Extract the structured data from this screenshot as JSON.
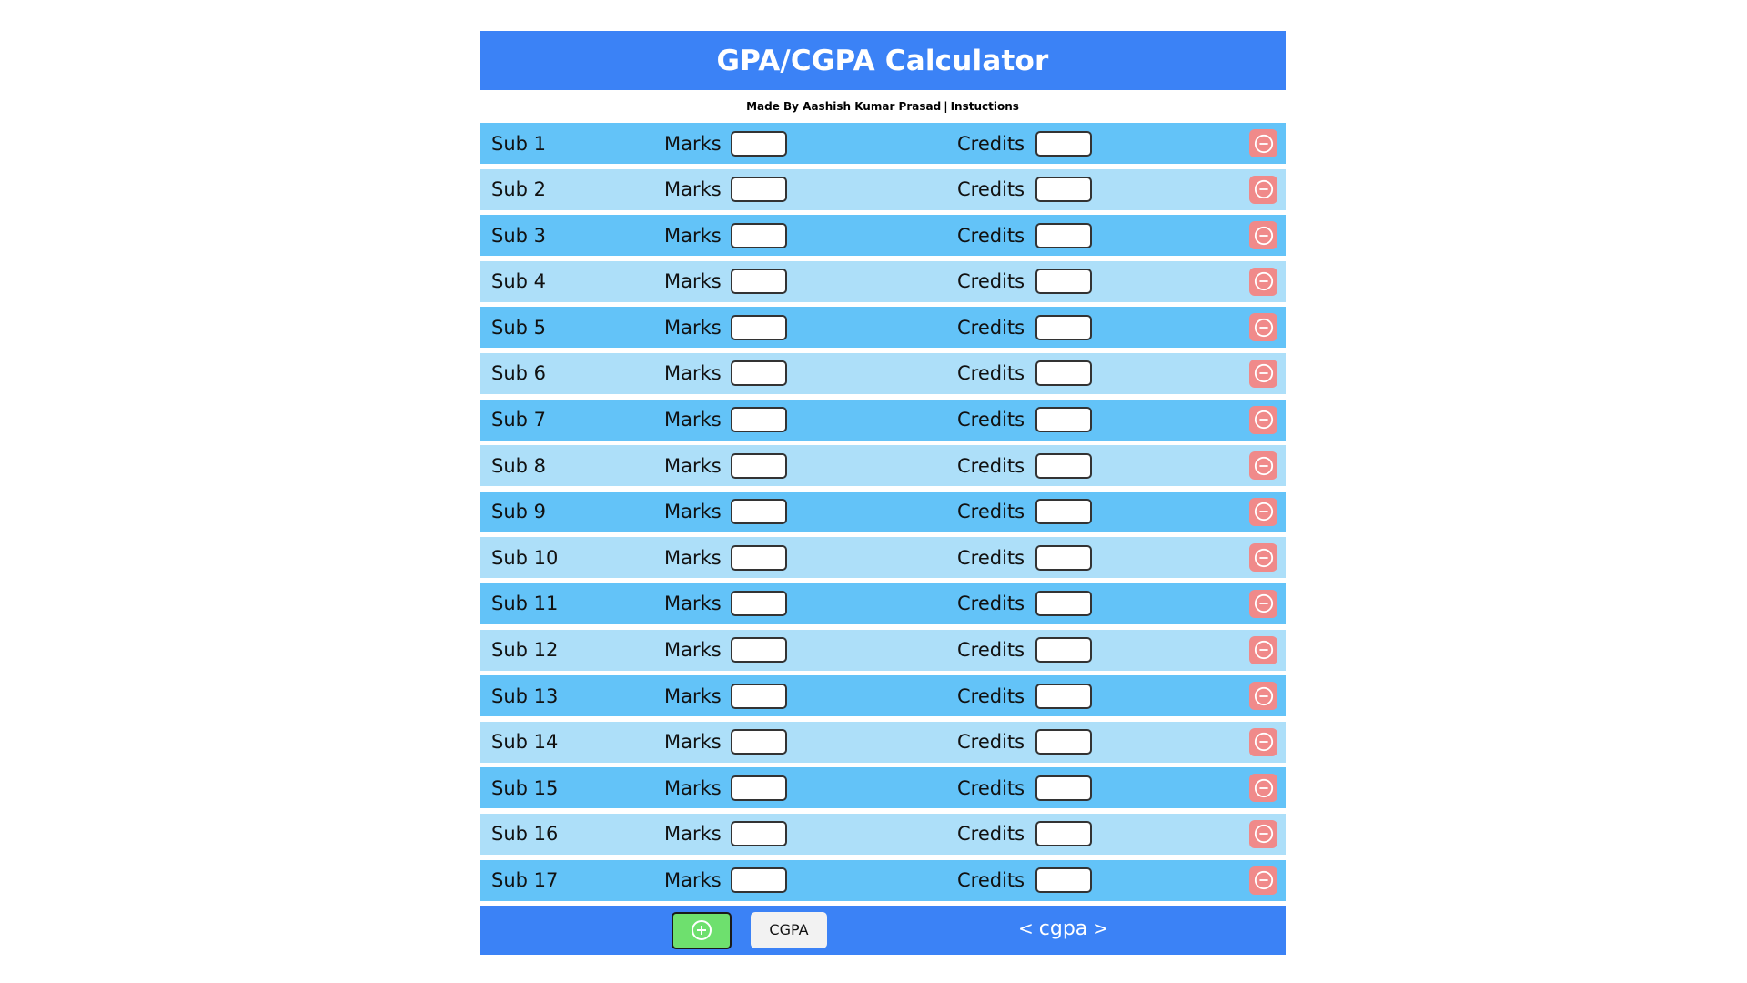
{
  "header": {
    "title": "GPA/CGPA Calculator"
  },
  "credit_line": {
    "author": "Made By Aashish Kumar Prasad",
    "separator": "|",
    "instructions_link": "Instuctions"
  },
  "labels": {
    "marks": "Marks",
    "credits": "Credits"
  },
  "subjects": [
    {
      "label": "Sub 1",
      "marks": "",
      "credits": ""
    },
    {
      "label": "Sub 2",
      "marks": "",
      "credits": ""
    },
    {
      "label": "Sub 3",
      "marks": "",
      "credits": ""
    },
    {
      "label": "Sub 4",
      "marks": "",
      "credits": ""
    },
    {
      "label": "Sub 5",
      "marks": "",
      "credits": ""
    },
    {
      "label": "Sub 6",
      "marks": "",
      "credits": ""
    },
    {
      "label": "Sub 7",
      "marks": "",
      "credits": ""
    },
    {
      "label": "Sub 8",
      "marks": "",
      "credits": ""
    },
    {
      "label": "Sub 9",
      "marks": "",
      "credits": ""
    },
    {
      "label": "Sub 10",
      "marks": "",
      "credits": ""
    },
    {
      "label": "Sub 11",
      "marks": "",
      "credits": ""
    },
    {
      "label": "Sub 12",
      "marks": "",
      "credits": ""
    },
    {
      "label": "Sub 13",
      "marks": "",
      "credits": ""
    },
    {
      "label": "Sub 14",
      "marks": "",
      "credits": ""
    },
    {
      "label": "Sub 15",
      "marks": "",
      "credits": ""
    },
    {
      "label": "Sub 16",
      "marks": "",
      "credits": ""
    },
    {
      "label": "Sub 17",
      "marks": "",
      "credits": ""
    }
  ],
  "footer": {
    "add_icon": "plus-circle-icon",
    "calculate_label": "CGPA",
    "mode_prev": "<",
    "mode_label": "cgpa",
    "mode_next": ">"
  },
  "icons": {
    "remove": "minus-circle-icon"
  },
  "colors": {
    "header_bg": "#3b82f6",
    "row_dark": "#63c3f8",
    "row_light": "#addff9",
    "remove_btn": "#f08a8a",
    "add_btn": "#6ee06e"
  }
}
